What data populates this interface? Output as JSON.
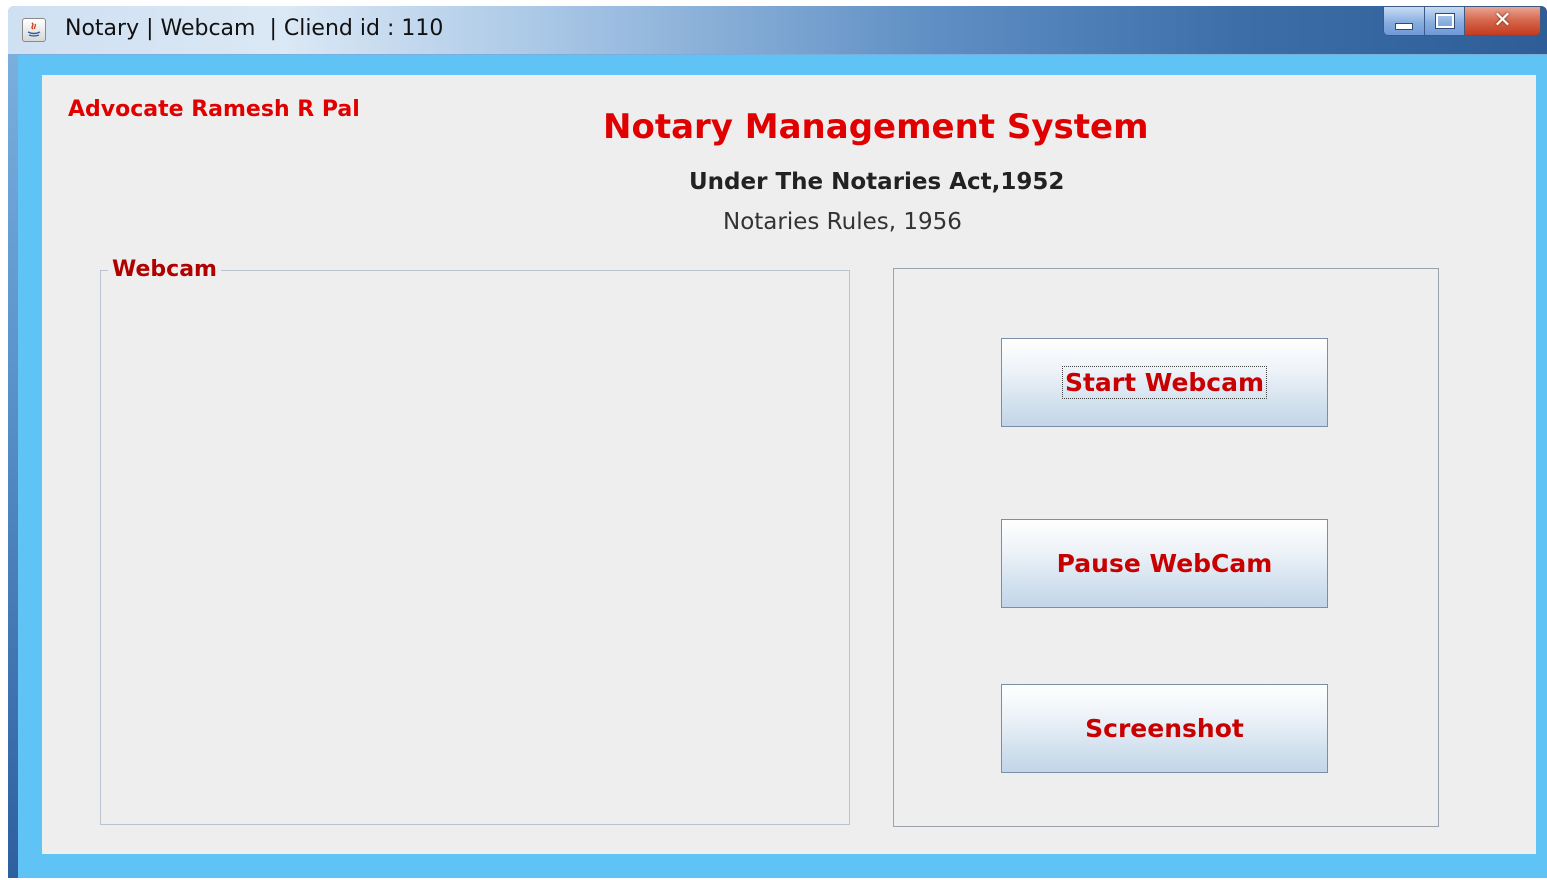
{
  "window": {
    "title": "Notary | Webcam  | Cliend id : 110",
    "controls": {
      "minimize_icon": "minimize-icon",
      "maximize_icon": "maximize-icon",
      "close_icon": "close-icon"
    }
  },
  "header": {
    "advocate": "Advocate Ramesh R Pal",
    "title": "Notary Management System",
    "subtitle": "Under The Notaries Act,1952",
    "rules": "Notaries Rules, 1956"
  },
  "webcam_panel": {
    "legend": "Webcam"
  },
  "controls": {
    "start_label": "Start Webcam",
    "pause_label": "Pause WebCam",
    "screenshot_label": "Screenshot"
  },
  "colors": {
    "accent_red": "#e00000",
    "frame_blue": "#5fc3f5",
    "panel_bg": "#eeeeee"
  }
}
